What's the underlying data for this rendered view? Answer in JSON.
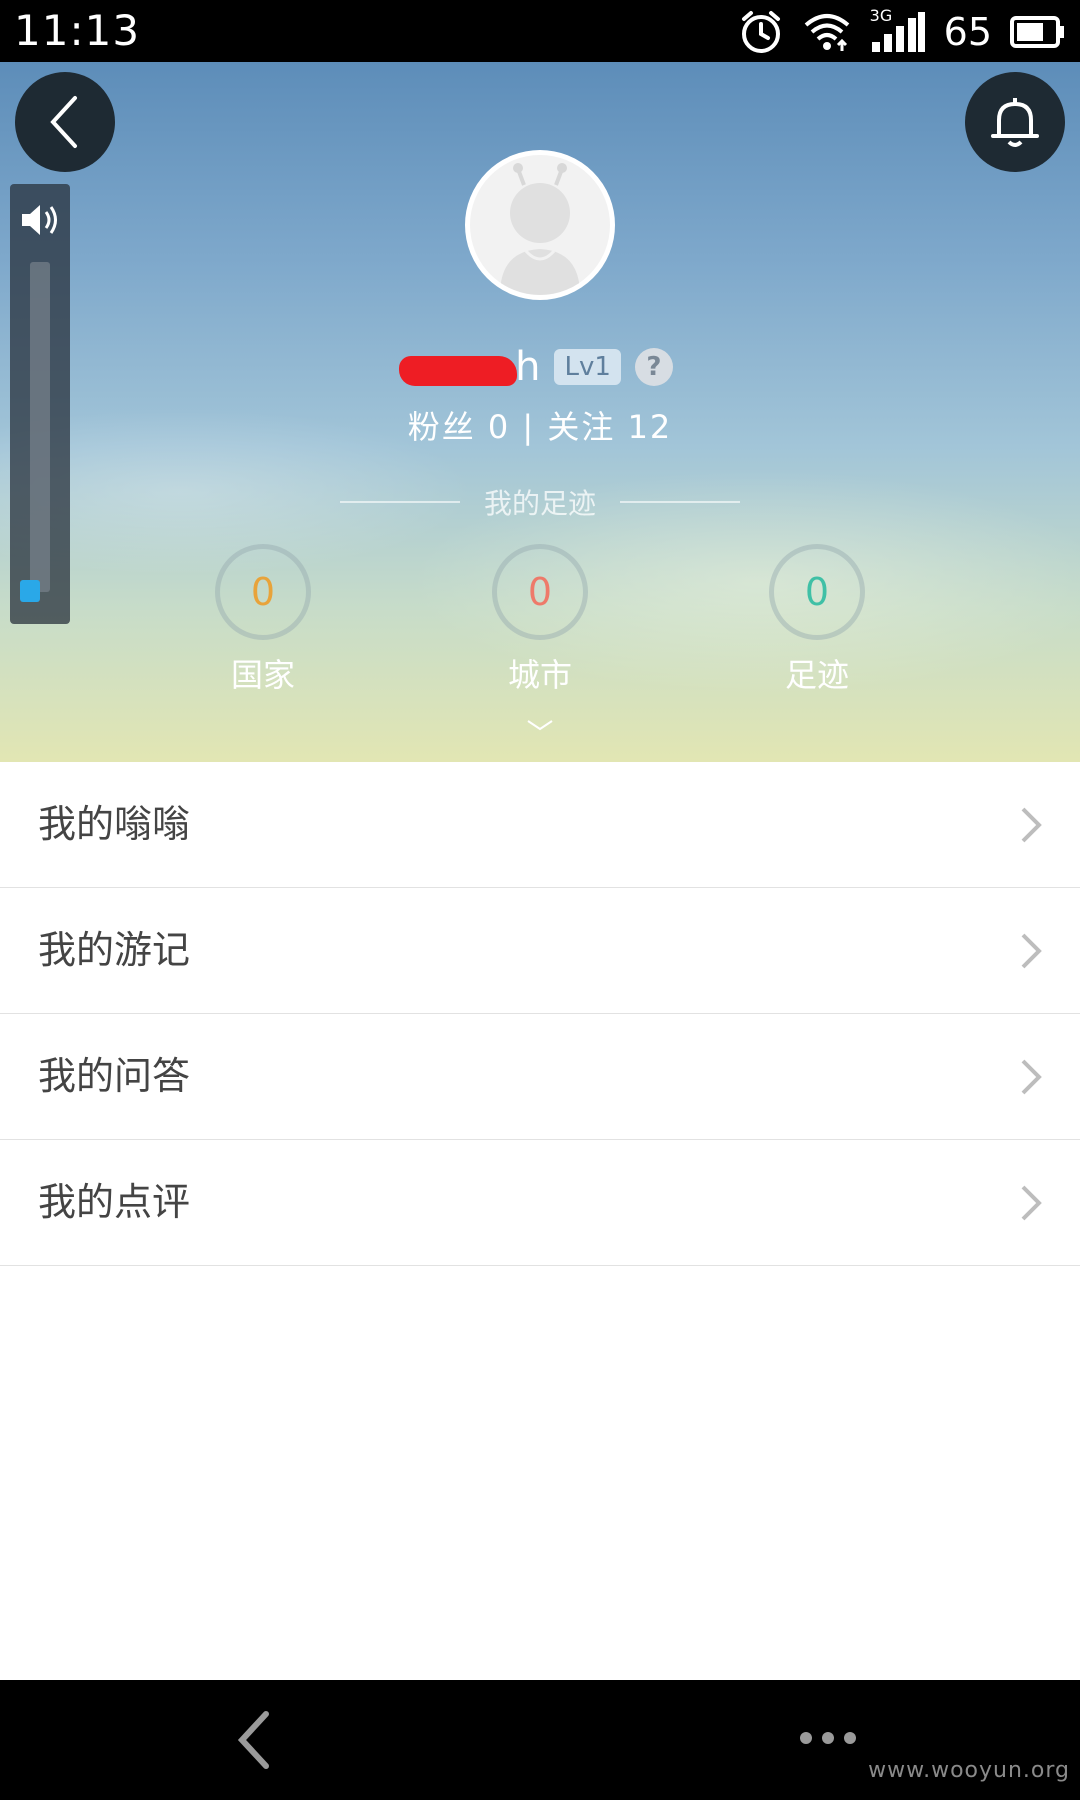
{
  "status_bar": {
    "time": "11:13",
    "network": "3G",
    "battery": "65",
    "icons": [
      "alarm-icon",
      "wifi-icon",
      "signal-icon",
      "battery-icon"
    ]
  },
  "header": {
    "username_visible": "h",
    "level": "Lv1",
    "help": "?",
    "fans_label": "粉丝",
    "fans_count": "0",
    "separator": "|",
    "follow_label": "关注",
    "follow_count": "12",
    "footprint_title": "我的足迹",
    "stats": [
      {
        "value": "0",
        "label": "国家",
        "color": "#e8a33a"
      },
      {
        "value": "0",
        "label": "城市",
        "color": "#ee7a6a"
      },
      {
        "value": "0",
        "label": "足迹",
        "color": "#3fc0a6"
      }
    ],
    "volume_level": 0.05
  },
  "menu": [
    {
      "label": "我的嗡嗡"
    },
    {
      "label": "我的游记"
    },
    {
      "label": "我的问答"
    },
    {
      "label": "我的点评"
    }
  ],
  "nav_bar": {
    "watermark": "www.wooyun.org"
  },
  "colors": {
    "accent_blue": "#2aa8e8",
    "redaction": "#ee1d24"
  }
}
